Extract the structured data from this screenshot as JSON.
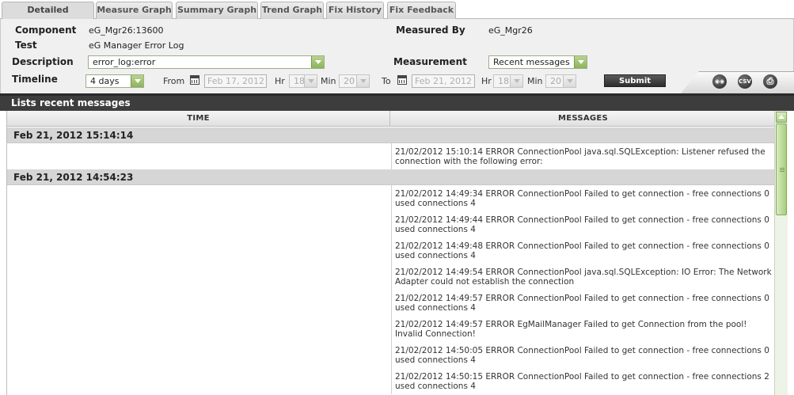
{
  "tabs": [
    {
      "label": "Detailed Diagnosis",
      "active": true
    },
    {
      "label": "Measure Graph",
      "active": false
    },
    {
      "label": "Summary Graph",
      "active": false
    },
    {
      "label": "Trend Graph",
      "active": false
    },
    {
      "label": "Fix History",
      "active": false
    },
    {
      "label": "Fix Feedback",
      "active": false
    }
  ],
  "info": {
    "component_label": "Component",
    "component_value": "eG_Mgr26:13600",
    "test_label": "Test",
    "test_value": "eG Manager Error Log",
    "description_label": "Description",
    "description_value": "error_log:error",
    "measured_by_label": "Measured By",
    "measured_by_value": "eG_Mgr26",
    "measurement_label": "Measurement",
    "measurement_value": "Recent messages"
  },
  "timeline": {
    "label": "Timeline",
    "period": "4 days",
    "from_label": "From",
    "from_date": "Feb 17, 2012",
    "from_hr_label": "Hr",
    "from_hr": "18",
    "from_min_label": "Min",
    "from_min": "20",
    "to_label": "To",
    "to_date": "Feb 21, 2012",
    "to_hr_label": "Hr",
    "to_hr": "18",
    "to_min_label": "Min",
    "to_min": "20",
    "submit_label": "Submit"
  },
  "toolbar_icons": [
    {
      "name": "binoculars-icon",
      "glyph": "◉◉"
    },
    {
      "name": "csv-icon",
      "glyph": "CSV"
    },
    {
      "name": "printer-icon",
      "glyph": "⎙"
    }
  ],
  "section_title": "Lists recent messages",
  "table": {
    "columns": [
      "TIME",
      "MESSAGES"
    ],
    "groups": [
      {
        "time": "Feb 21, 2012 15:14:14",
        "messages": [
          "21/02/2012 15:10:14 ERROR ConnectionPool java.sql.SQLException: Listener refused the connection with the following error:"
        ]
      },
      {
        "time": "Feb 21, 2012 14:54:23",
        "messages": [
          "21/02/2012 14:49:34 ERROR ConnectionPool Failed to get connection - free connections 0 used connections 4",
          "21/02/2012 14:49:44 ERROR ConnectionPool Failed to get connection - free connections 0 used connections 4",
          "21/02/2012 14:49:48 ERROR ConnectionPool Failed to get connection - free connections 0 used connections 4",
          "21/02/2012 14:49:54 ERROR ConnectionPool java.sql.SQLException: IO Error: The Network Adapter could not establish the connection",
          "21/02/2012 14:49:57 ERROR ConnectionPool Failed to get connection - free connections 0 used connections 4",
          "21/02/2012 14:49:57 ERROR EgMailManager Failed to get Connection from the pool! Invalid Connection!",
          "21/02/2012 14:50:05 ERROR ConnectionPool Failed to get connection - free connections 0 used connections 4",
          "21/02/2012 14:50:15 ERROR ConnectionPool Failed to get connection - free connections 2 used connections 4"
        ]
      }
    ]
  }
}
